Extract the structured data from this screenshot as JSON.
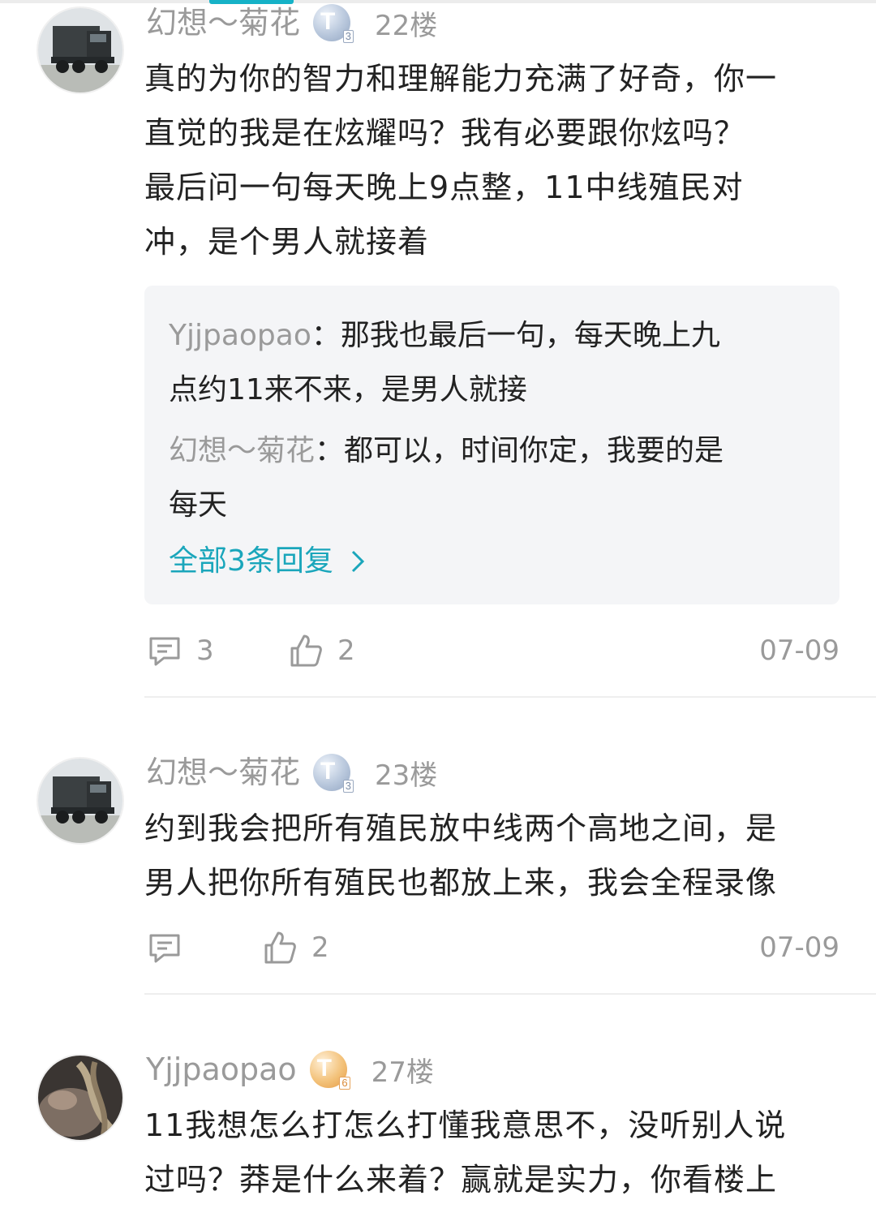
{
  "comments": [
    {
      "user": "幻想～菊花",
      "badge": "T3",
      "badge_letter": "T",
      "badge_level": "3",
      "floor": "22楼",
      "lines": [
        "真的为你的智力和理解能力充满了好奇，你一",
        "直觉的我是在炫耀吗？我有必要跟你炫吗？",
        "最后问一句每天晚上9点整，11中线殖民对",
        "冲，是个男人就接着"
      ],
      "replies": [
        {
          "name": "Yjjpaopao",
          "sep": "：",
          "text_lines": [
            "那我也最后一句，每天晚上九",
            "点约11来不来，是男人就接"
          ]
        },
        {
          "name": "幻想～菊花",
          "sep": "：",
          "text_lines": [
            "都可以，时间你定，我要的是",
            "每天"
          ]
        }
      ],
      "all_replies": "全部3条回复",
      "comment_count": "3",
      "like_count": "2",
      "date": "07-09"
    },
    {
      "user": "幻想～菊花",
      "badge": "T3",
      "badge_letter": "T",
      "badge_level": "3",
      "floor": "23楼",
      "lines": [
        "约到我会把所有殖民放中线两个高地之间，是",
        "男人把你所有殖民也都放上来，我会全程录像"
      ],
      "comment_count": "",
      "like_count": "2",
      "date": "07-09"
    },
    {
      "user": "Yjjpaopao",
      "badge": "T6",
      "badge_letter": "T",
      "badge_level": "6",
      "floor": "27楼",
      "lines": [
        "11我想怎么打怎么打懂我意思不，没听别人说",
        "过吗？莽是什么来着？赢就是实力，你看楼上"
      ]
    }
  ],
  "icons": {
    "comment": "comment-icon",
    "like": "thumbs-up-icon",
    "more_replies": "chevron-right-icon"
  },
  "colors": {
    "accent": "#16b2c7",
    "link": "#1aa6bb",
    "meta_text": "#9a9a9a",
    "body_text": "#222222",
    "reply_bg": "#f4f5f7",
    "badge_silver": "#b8c7dc",
    "badge_gold": "#f3c27a"
  }
}
